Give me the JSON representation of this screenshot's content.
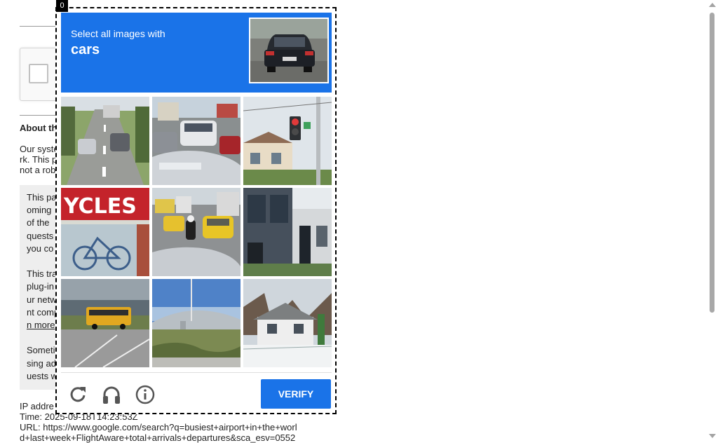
{
  "background_page": {
    "about_heading": "About th",
    "about_lines": [
      "Our syste",
      "rk. This p",
      "not a rob"
    ],
    "info_paragraphs": [
      [
        "This pa",
        "oming",
        "of the",
        "quests",
        "you co"
      ],
      [
        "This tra",
        "plug-in",
        "ur netw",
        "nt comp",
        "n more"
      ],
      [
        "Someti",
        "sing ad",
        "uests w"
      ]
    ],
    "footer": {
      "ip_label": "IP addre",
      "time": "Time: 2025-09-18T14:23:53Z",
      "url_line1": "URL: https://www.google.com/search?q=busiest+airport+in+the+worl",
      "url_line2": "d+last+week+FlightAware+total+arrivals+departures&sca_esv=0552"
    }
  },
  "challenge": {
    "index_badge": "0",
    "instruction": "Select all images with",
    "target_object": "cars",
    "sample_image_icon": "car-rear-photo",
    "tiles": [
      {
        "row": 1,
        "col": 1,
        "icon": "road-with-cars-photo",
        "selected": false
      },
      {
        "row": 1,
        "col": 2,
        "icon": "parked-cars-photo",
        "selected": false
      },
      {
        "row": 1,
        "col": 3,
        "icon": "traffic-light-photo",
        "selected": false
      },
      {
        "row": 2,
        "col": 1,
        "icon": "cycles-storefront-photo",
        "selected": false
      },
      {
        "row": 2,
        "col": 2,
        "icon": "taxi-traffic-photo",
        "selected": false
      },
      {
        "row": 2,
        "col": 3,
        "icon": "building-facade-photo",
        "selected": false
      },
      {
        "row": 3,
        "col": 1,
        "icon": "school-bus-photo",
        "selected": false
      },
      {
        "row": 3,
        "col": 2,
        "icon": "bridge-landscape-photo",
        "selected": false
      },
      {
        "row": 3,
        "col": 3,
        "icon": "snowy-house-photo",
        "selected": false
      }
    ],
    "buttons": {
      "reload_icon": "reload-icon",
      "audio_icon": "headphones-icon",
      "info_icon": "info-icon",
      "verify_label": "VERIFY"
    },
    "colors": {
      "accent": "#1a73e8",
      "header_text": "#ffffff"
    }
  }
}
